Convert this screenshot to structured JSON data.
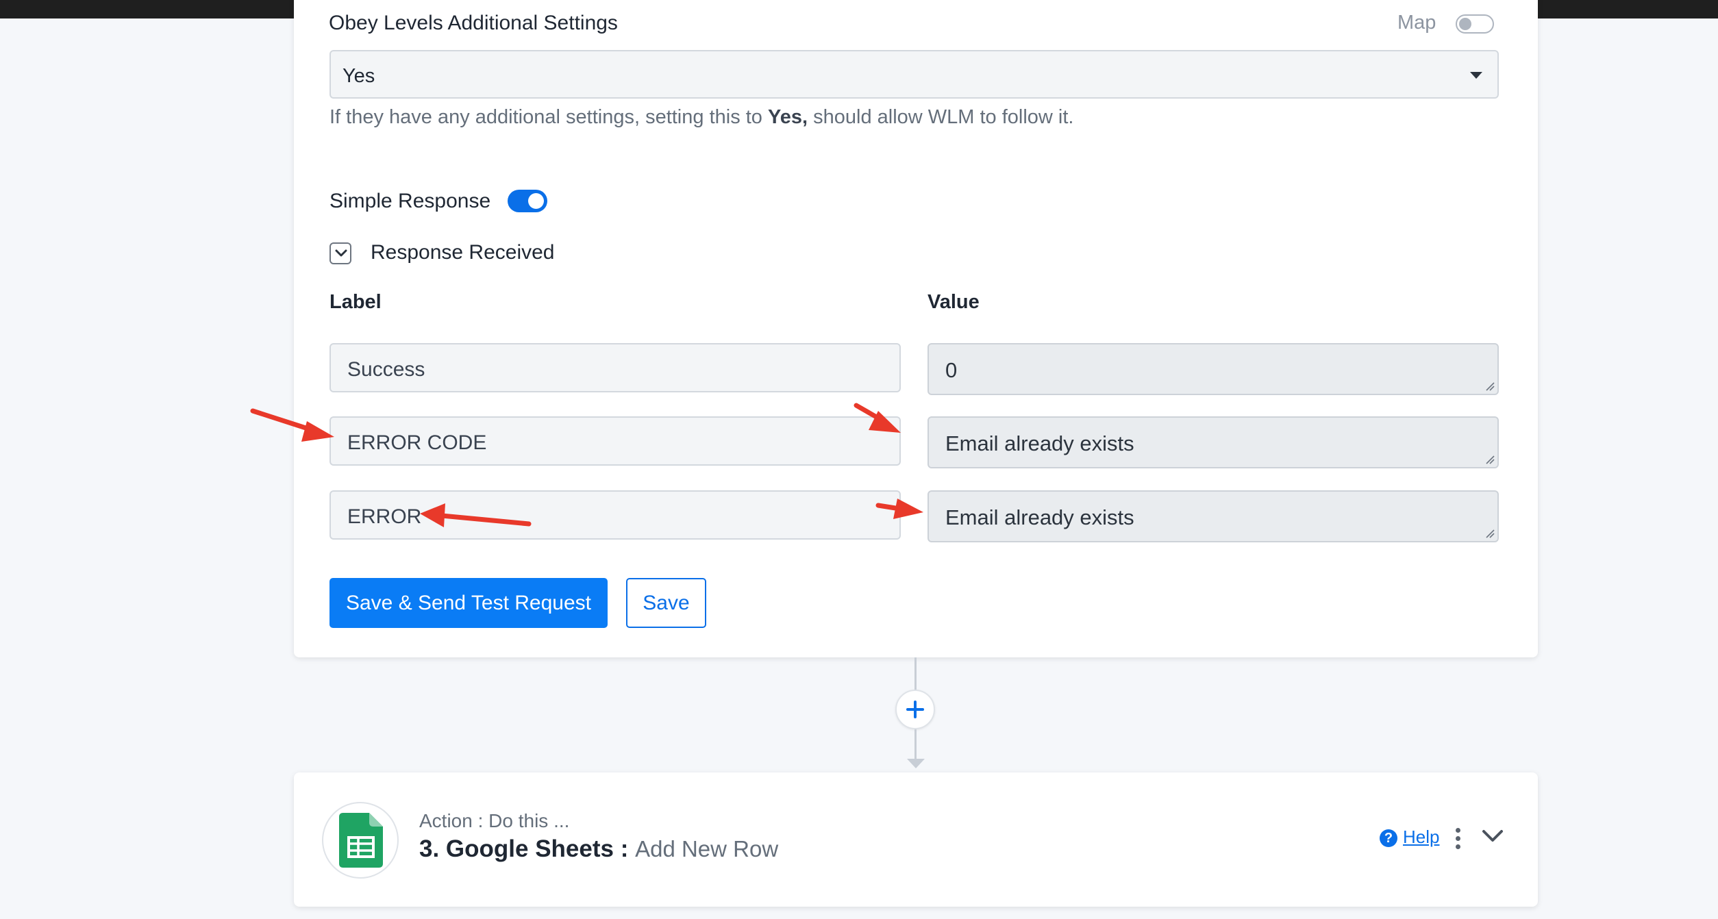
{
  "settings": {
    "field_title": "Obey Levels Additional Settings",
    "map_label": "Map",
    "select_value": "Yes",
    "help_prefix": "If they have any additional settings, setting this to ",
    "help_bold": "Yes,",
    "help_suffix": " should allow WLM to follow it."
  },
  "response": {
    "simple_response_label": "Simple Response",
    "response_received_label": "Response Received",
    "label_header": "Label",
    "value_header": "Value",
    "rows": [
      {
        "label": "Success",
        "value": "0"
      },
      {
        "label": "ERROR CODE",
        "value": "Email already exists"
      },
      {
        "label": "ERROR",
        "value": "Email already exists"
      }
    ]
  },
  "buttons": {
    "save_send": "Save & Send Test Request",
    "save": "Save"
  },
  "action": {
    "subtitle": "Action : Do this ...",
    "step": "3. Google Sheets",
    "colon": " : ",
    "event": "Add New Row",
    "help_label": "Help"
  },
  "colors": {
    "accent": "#0a7cf5",
    "annotation": "#e8392a",
    "sheets_green": "#1fa463"
  },
  "icons": [
    "plus-icon",
    "google-sheets-icon",
    "help-circle-icon",
    "kebab-menu-icon",
    "chevron-down-icon",
    "dropdown-caret-icon",
    "resize-grip-icon"
  ]
}
